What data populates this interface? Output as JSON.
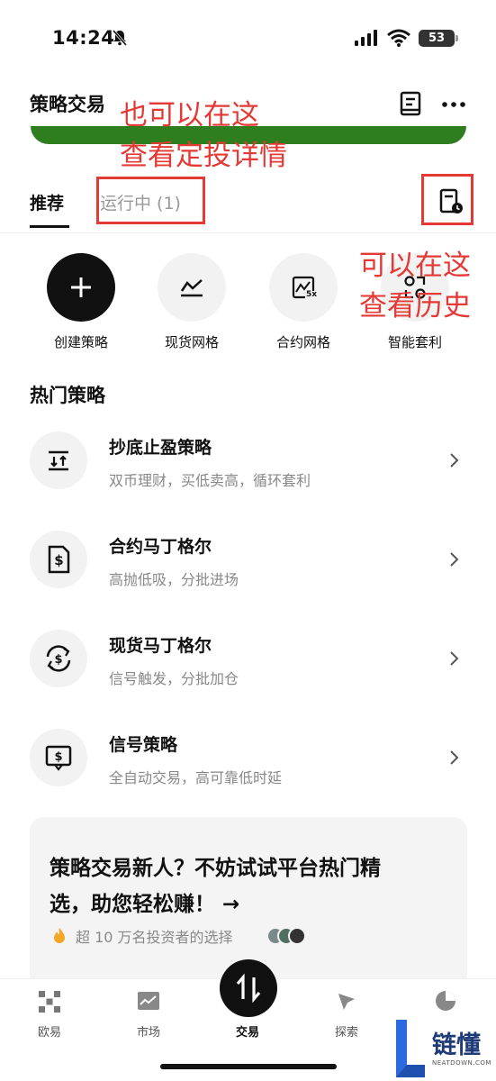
{
  "status_bar": {
    "time": "14:24",
    "battery": "53"
  },
  "header": {
    "title": "策略交易"
  },
  "annotations": {
    "top_line1": "也可以在这",
    "top_line2": "查看定投详情",
    "right_line1": "可以在这",
    "right_line2": "查看历史"
  },
  "tabs": [
    {
      "label": "推荐",
      "active": true
    },
    {
      "label": "运行中 (1)",
      "active": false
    }
  ],
  "quick_actions": [
    {
      "label": "创建策略",
      "icon": "plus-icon"
    },
    {
      "label": "现货网格",
      "icon": "grid-chart-icon"
    },
    {
      "label": "合约网格",
      "icon": "leverage-grid-icon",
      "badge": "5x"
    },
    {
      "label": "智能套利",
      "icon": "arbitrage-icon"
    }
  ],
  "section_title": "热门策略",
  "strategies": [
    {
      "title": "抄底止盈策略",
      "subtitle": "双币理财，买低卖高，循环套利",
      "icon": "buy-low-icon"
    },
    {
      "title": "合约马丁格尔",
      "subtitle": "高抛低吸，分批进场",
      "icon": "dollar-document-icon"
    },
    {
      "title": "现货马丁格尔",
      "subtitle": "信号触发，分批加仓",
      "icon": "dollar-cycle-icon"
    },
    {
      "title": "信号策略",
      "subtitle": "全自动交易，高可靠低时延",
      "icon": "signal-screen-icon"
    }
  ],
  "promo": {
    "line1": "策略交易新人？不妨试试平台热门精",
    "line2": "选，助您轻松赚！ →",
    "note": "超 10 万名投资者的选择"
  },
  "bottom_nav": [
    {
      "label": "欧易",
      "icon": "okx-logo-icon"
    },
    {
      "label": "市场",
      "icon": "market-chart-icon"
    },
    {
      "label": "交易",
      "icon": "trade-arrows-icon",
      "active": true
    },
    {
      "label": "探索",
      "icon": "compass-icon"
    },
    {
      "label": "资产",
      "icon": "pie-chart-icon"
    }
  ],
  "watermark": {
    "text": "链懂",
    "sub": "NEATDOWN.COM"
  },
  "colors": {
    "annotation": "#e53935",
    "accent_green": "#2e7d1e",
    "primary": "#111111",
    "muted": "#888888"
  }
}
